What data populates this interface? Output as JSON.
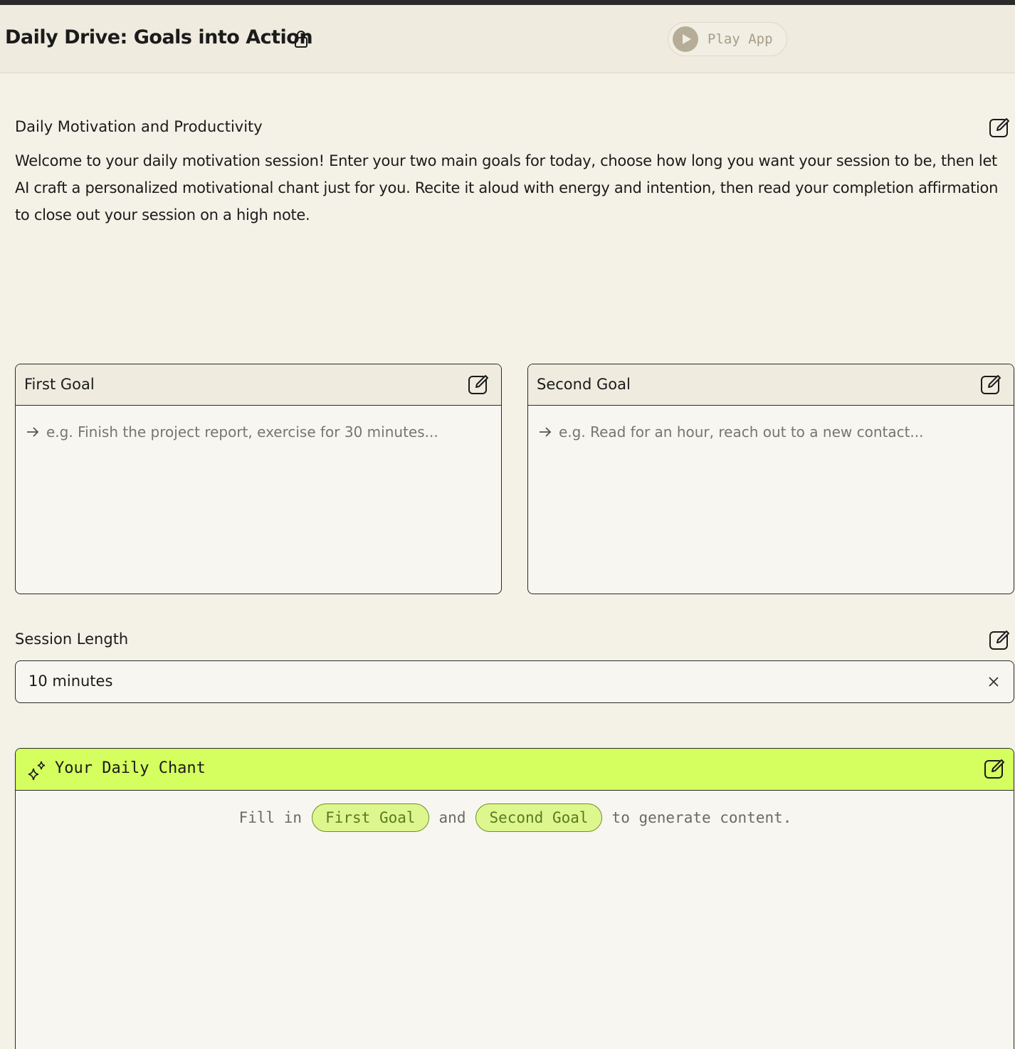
{
  "header": {
    "title": "Daily Drive: Goals into Action",
    "play_label": "Play App"
  },
  "description": {
    "title": "Daily Motivation and Productivity",
    "body": "Welcome to your daily motivation session! Enter your two main goals for today, choose how long you want your session to be, then let AI craft a personalized motivational chant just for you. Recite it aloud with energy and intention, then read your completion affirmation to close out your session on a high note."
  },
  "goals": [
    {
      "label": "First Goal",
      "placeholder": "e.g. Finish the project report, exercise for 30 minutes..."
    },
    {
      "label": "Second Goal",
      "placeholder": "e.g. Read for an hour, reach out to a new contact..."
    }
  ],
  "session": {
    "label": "Session Length",
    "value": "10 minutes"
  },
  "chant": {
    "title": "Your Daily Chant",
    "msg_prefix": "Fill in",
    "chip_1": "First Goal",
    "msg_and": "and",
    "chip_2": "Second Goal",
    "msg_suffix": "to generate content."
  },
  "colors": {
    "background": "#f4f1e7",
    "accent": "#d4ff5e",
    "chip_bg": "#ddf78e"
  },
  "icons": [
    "lock-icon",
    "play-icon",
    "edit-icon",
    "arrow-right-icon",
    "close-icon",
    "sparkle-icon"
  ]
}
